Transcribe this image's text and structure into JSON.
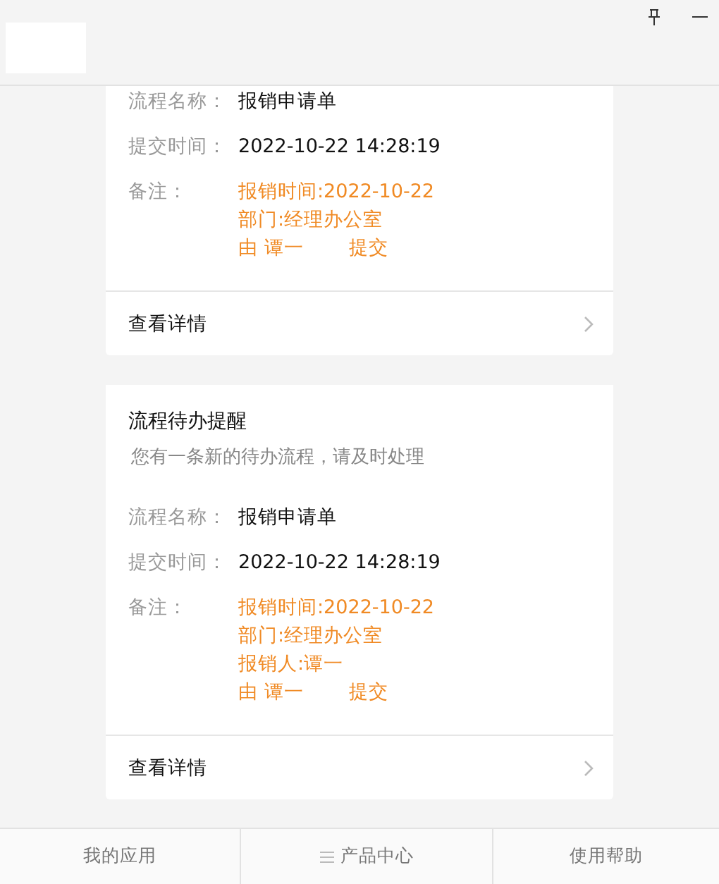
{
  "cards": [
    {
      "fields": [
        {
          "label": "流程名称：",
          "value": "报销申请单"
        },
        {
          "label": "提交时间：",
          "value": "2022-10-22 14:28:19"
        }
      ],
      "notes": {
        "label": "备注：",
        "lines": [
          "报销时间:2022-10-22",
          "部门:经理办公室"
        ],
        "submitter": "由 谭一",
        "action": "提交"
      },
      "details": "查看详情"
    },
    {
      "title": "流程待办提醒",
      "subtitle": "您有一条新的待办流程，请及时处理",
      "fields": [
        {
          "label": "流程名称：",
          "value": "报销申请单"
        },
        {
          "label": "提交时间：",
          "value": "2022-10-22 14:28:19"
        }
      ],
      "notes": {
        "label": "备注：",
        "lines": [
          "报销时间:2022-10-22",
          "部门:经理办公室",
          "报销人:谭一"
        ],
        "submitter": "由 谭一",
        "action": "提交"
      },
      "details": "查看详情"
    }
  ],
  "footer_tabs": [
    {
      "label": "我的应用",
      "kind": "plain"
    },
    {
      "label": "产品中心",
      "kind": "menu"
    },
    {
      "label": "使用帮助",
      "kind": "plain"
    }
  ]
}
